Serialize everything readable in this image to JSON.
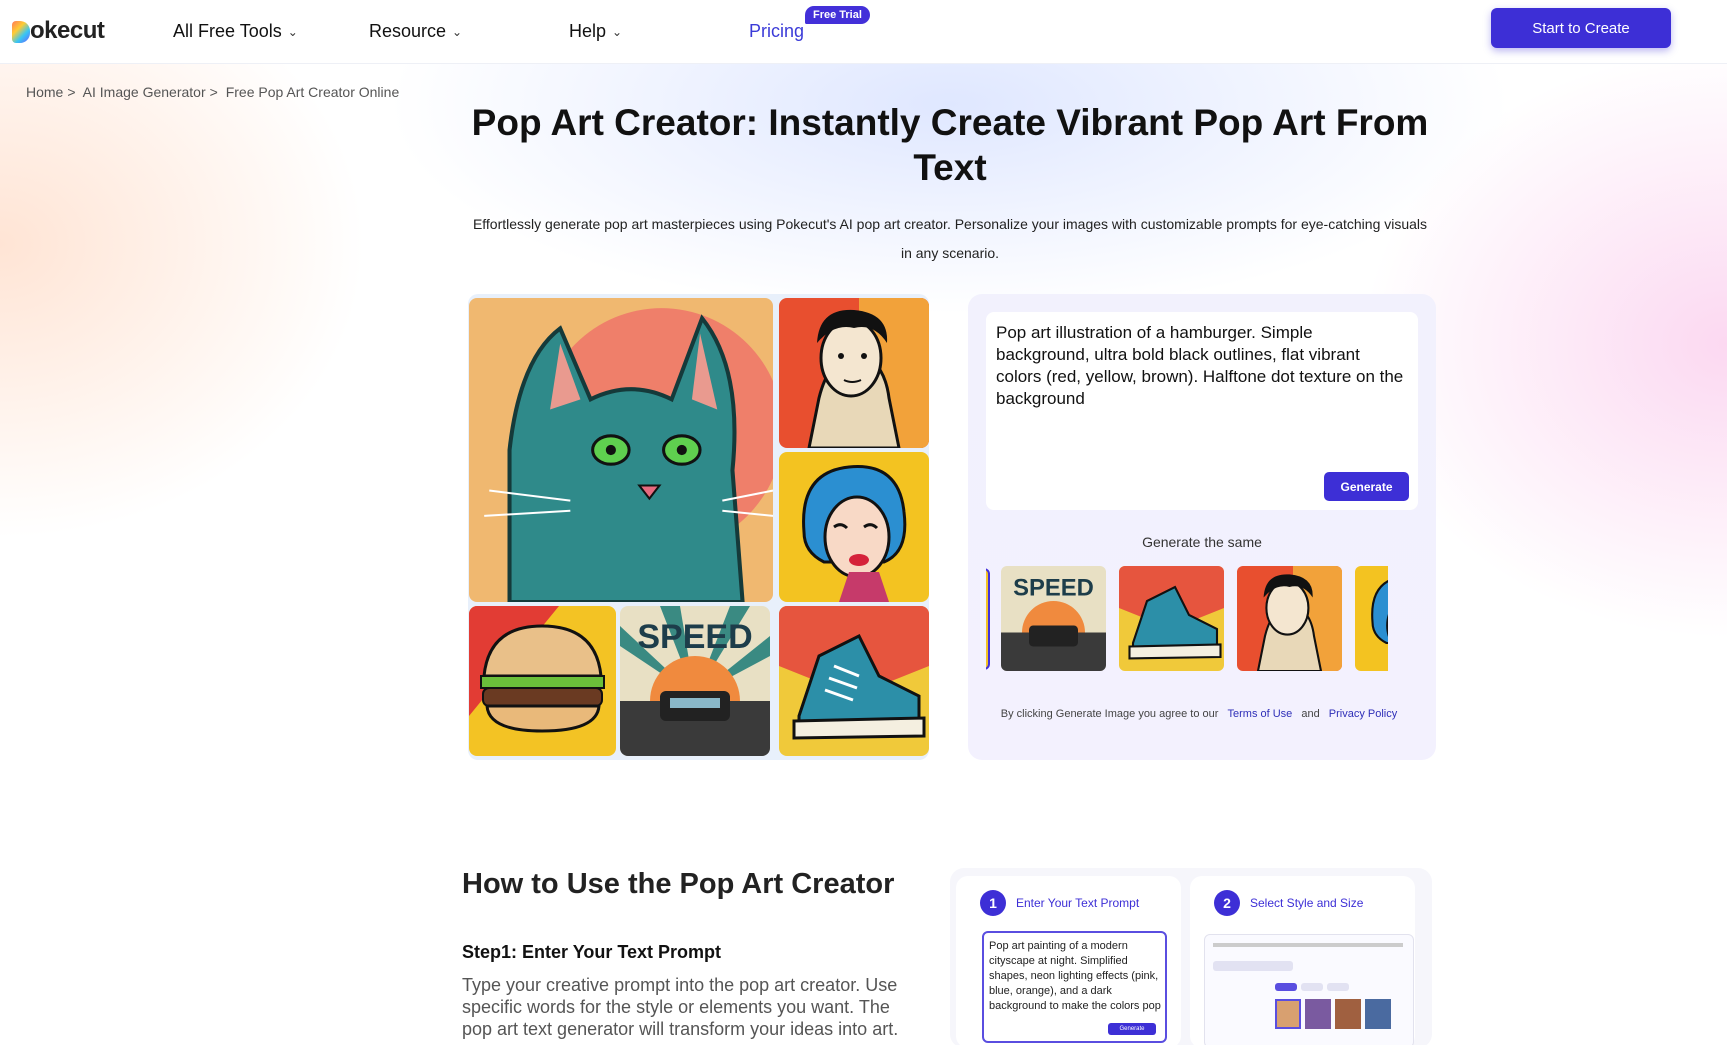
{
  "header": {
    "logo_text": "okecut",
    "nav": [
      {
        "label": "All Free Tools",
        "has_dropdown": true
      },
      {
        "label": "Resource",
        "has_dropdown": true
      },
      {
        "label": "Help",
        "has_dropdown": true
      },
      {
        "label": "Pricing",
        "has_dropdown": false
      }
    ],
    "badge": "Free Trial",
    "cta": "Start to Create"
  },
  "breadcrumb": [
    "Home",
    ">",
    "AI Image Generator",
    ">",
    "Free Pop Art Creator Online"
  ],
  "hero": {
    "title": "Pop Art Creator: Instantly Create Vibrant Pop Art From Text",
    "subtitle": "Effortlessly generate pop art masterpieces using Pokecut's AI pop art creator. Personalize your images with customizable prompts for eye-catching visuals in any scenario."
  },
  "gallery": {
    "tiles": [
      "cat",
      "man-portrait",
      "woman-portrait",
      "hamburger",
      "speed-car",
      "sneaker"
    ],
    "speed_text": "SPEED"
  },
  "generator": {
    "prompt": "Pop art illustration of a hamburger. Simple background, ultra bold black outlines, flat vibrant colors (red, yellow, brown). Halftone dot texture on the background",
    "generate_label": "Generate",
    "same_label": "Generate the same",
    "thumbs": [
      "speed-car",
      "sneaker",
      "man-portrait",
      "woman-portrait"
    ],
    "agree_prefix": "By clicking Generate Image you agree to our",
    "terms": "Terms of Use",
    "and": "and",
    "privacy": "Privacy Policy"
  },
  "how_to": {
    "title": "How to Use the Pop Art Creator",
    "step1_title": "Step1: Enter Your Text Prompt",
    "step1_desc": "Type your creative prompt into the pop art creator. Use specific words for the style or elements you want. The pop art text generator will transform your ideas into art.",
    "card1_num": "1",
    "card1_label": "Enter Your Text Prompt",
    "card1_prompt": "Pop art painting of a modern cityscape at night. Simplified shapes, neon lighting effects (pink, blue, orange), and a dark background to make the colors pop",
    "card1_gen": "Generate",
    "card2_num": "2",
    "card2_label": "Select Style and Size"
  },
  "colors": {
    "primary": "#3d2fd6",
    "link": "#2f2fb8"
  }
}
